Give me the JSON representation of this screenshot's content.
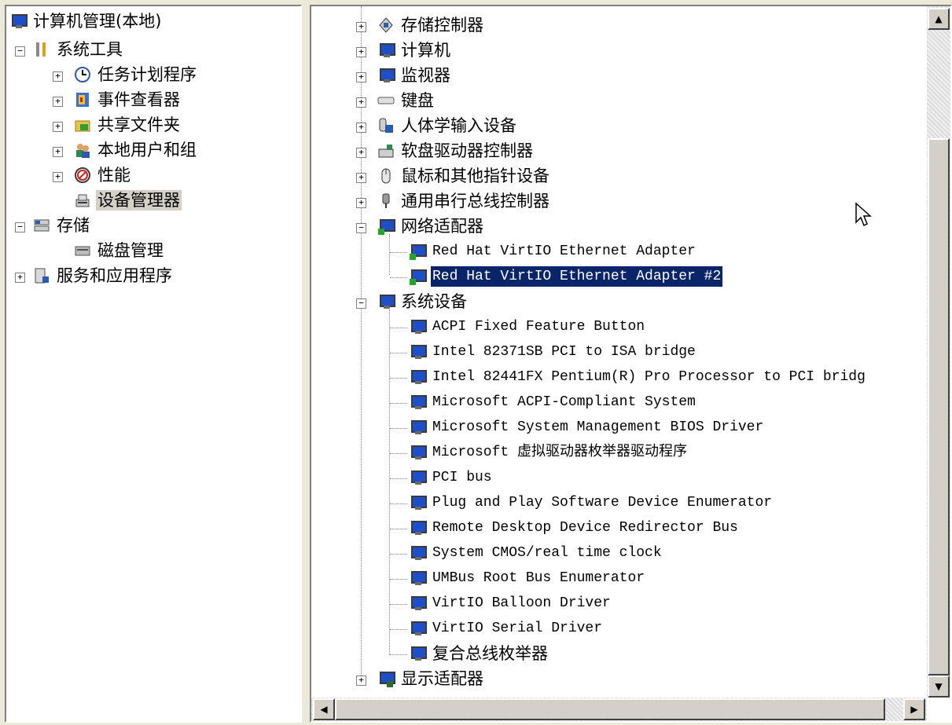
{
  "left_tree": {
    "root": "计算机管理(本地)",
    "system_tools": "系统工具",
    "task_scheduler": "任务计划程序",
    "event_viewer": "事件查看器",
    "shared_folders": "共享文件夹",
    "local_users": "本地用户和组",
    "performance": "性能",
    "device_manager": "设备管理器",
    "storage": "存储",
    "disk_management": "磁盘管理",
    "services_apps": "服务和应用程序"
  },
  "right_tree": {
    "storage_controllers": "存储控制器",
    "computer": "计算机",
    "monitors": "监视器",
    "keyboards": "键盘",
    "hid": "人体学输入设备",
    "floppy_controllers": "软盘驱动器控制器",
    "mice": "鼠标和其他指针设备",
    "usb_controllers": "通用串行总线控制器",
    "network_adapters": "网络适配器",
    "net_items": [
      "Red Hat VirtIO Ethernet Adapter",
      "Red Hat VirtIO Ethernet Adapter #2"
    ],
    "system_devices": "系统设备",
    "sys_items": [
      "ACPI Fixed Feature Button",
      "Intel 82371SB PCI to ISA bridge",
      "Intel 82441FX Pentium(R) Pro Processor to PCI bridg",
      "Microsoft ACPI-Compliant System",
      "Microsoft System Management BIOS Driver",
      "Microsoft 虚拟驱动器枚举器驱动程序",
      "PCI bus",
      "Plug and Play Software Device Enumerator",
      "Remote Desktop Device Redirector Bus",
      "System CMOS/real time clock",
      "UMBus Root Bus Enumerator",
      "VirtIO Balloon Driver",
      "VirtIO Serial Driver",
      "复合总线枚举器"
    ],
    "display_adapters": "显示适配器"
  },
  "icons": {
    "expand": "+",
    "collapse": "−",
    "scroll_up": "▲",
    "scroll_down": "▼",
    "scroll_left": "◀",
    "scroll_right": "▶"
  }
}
